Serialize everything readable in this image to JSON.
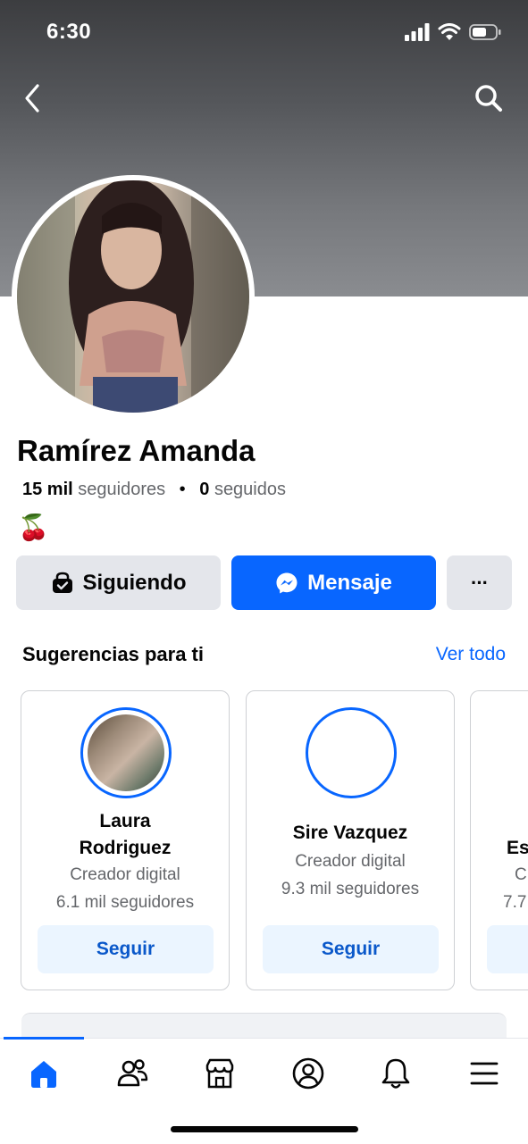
{
  "status_bar": {
    "time": "6:30"
  },
  "profile": {
    "name": "Ramírez Amanda",
    "followers_count": "15 mil",
    "followers_label": "seguidores",
    "separator": "•",
    "following_count": "0",
    "following_label": "seguidos",
    "bio_emoji": "🍒"
  },
  "actions": {
    "following_label": "Siguiendo",
    "message_label": "Mensaje",
    "more_label": "···"
  },
  "suggestions": {
    "title": "Sugerencias para ti",
    "see_all": "Ver todo",
    "cards": [
      {
        "name_line1": "Laura",
        "name_line2": "Rodriguez",
        "role": "Creador digital",
        "followers": "6.1 mil seguidores",
        "button": "Seguir"
      },
      {
        "name_line1": "Sire Vazquez",
        "role": "Creador digital",
        "followers": "9.3 mil seguidores",
        "button": "Seguir"
      },
      {
        "name_line1": "Es",
        "role": "C",
        "followers": "7.7"
      }
    ]
  },
  "tabbar": {
    "items": [
      "home-icon",
      "friends-icon",
      "marketplace-icon",
      "profile-icon",
      "notifications-icon",
      "menu-icon"
    ],
    "active": "home-icon"
  },
  "colors": {
    "accent": "#0866ff",
    "secondary_button": "#e4e6eb",
    "follow_button_bg": "#ebf5ff"
  }
}
